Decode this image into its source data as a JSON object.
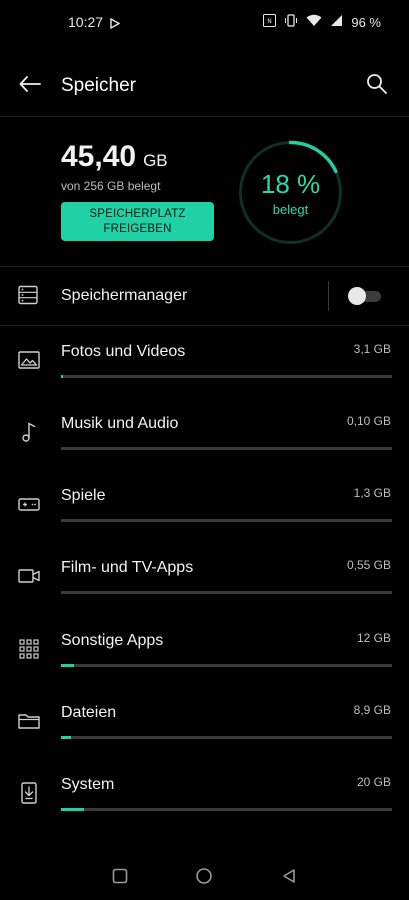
{
  "status_bar": {
    "time": "10:27",
    "battery_text": "96 %",
    "icons": [
      "play-store-notification-icon",
      "nfc-icon",
      "vibrate-icon",
      "wifi-icon",
      "signal-icon"
    ]
  },
  "app_bar": {
    "title": "Speicher",
    "back_icon": "arrow-back-icon",
    "search_icon": "search-icon"
  },
  "summary": {
    "used_value": "45,40",
    "used_unit": "GB",
    "subtitle": "von 256 GB belegt",
    "free_button_line1": "SPEICHERPLATZ",
    "free_button_line2": "FREIGEBEN",
    "ring_percent_text": "18 %",
    "ring_label": "belegt",
    "ring_fraction": 0.18,
    "accent_color": "#1fd1a5"
  },
  "storage_manager": {
    "label": "Speichermanager",
    "toggle_on": false
  },
  "categories": [
    {
      "label": "Fotos und Videos",
      "size": "3,1 GB",
      "fraction": 0.007,
      "icon": "image-icon"
    },
    {
      "label": "Musik und Audio",
      "size": "0,10 GB",
      "fraction": 0.0,
      "icon": "music-note-icon"
    },
    {
      "label": "Spiele",
      "size": "1,3 GB",
      "fraction": 0.0,
      "icon": "gamepad-icon"
    },
    {
      "label": "Film- und TV-Apps",
      "size": "0,55 GB",
      "fraction": 0.0,
      "icon": "video-camera-icon"
    },
    {
      "label": "Sonstige Apps",
      "size": "12 GB",
      "fraction": 0.04,
      "icon": "apps-grid-icon"
    },
    {
      "label": "Dateien",
      "size": "8,9 GB",
      "fraction": 0.03,
      "icon": "folder-icon"
    },
    {
      "label": "System",
      "size": "20 GB",
      "fraction": 0.07,
      "icon": "system-update-icon"
    }
  ],
  "nav_bar": {
    "icons": [
      "recents-square-icon",
      "home-circle-icon",
      "back-triangle-icon"
    ]
  }
}
